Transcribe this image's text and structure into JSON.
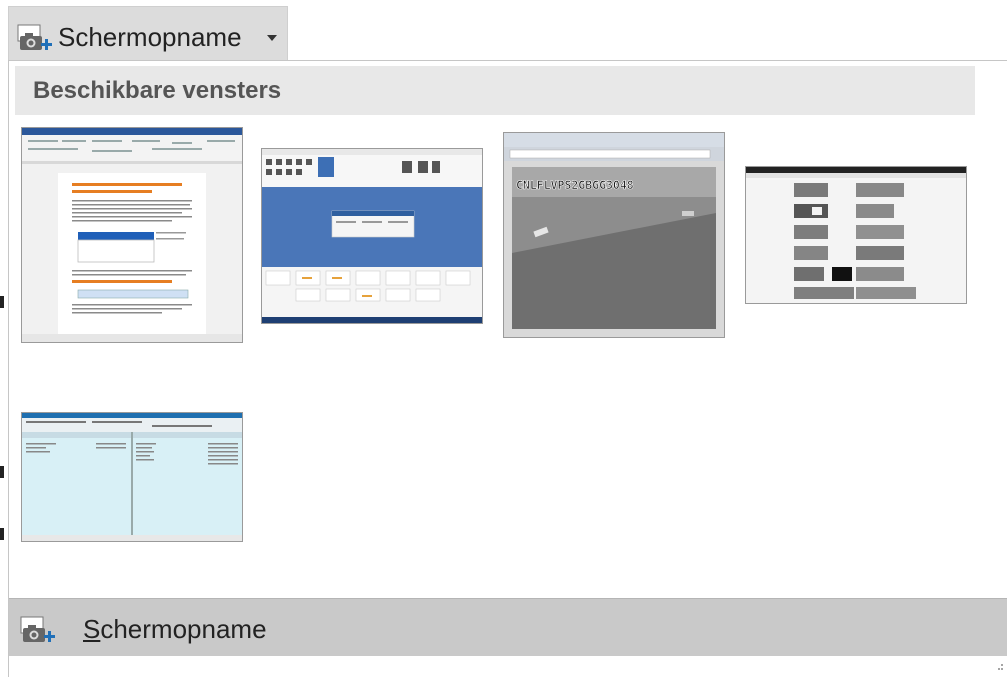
{
  "ribbon": {
    "label": "Schermopname",
    "icon": "camera-plus-icon"
  },
  "section": {
    "title": "Beschikbare vensters"
  },
  "windows": [
    {
      "name": "window-thumbnail-word-document"
    },
    {
      "name": "window-thumbnail-dialog-app"
    },
    {
      "name": "window-thumbnail-camera-viewer",
      "overlay_text": "CNLFLVPS2GBGG3048"
    },
    {
      "name": "window-thumbnail-photo-gallery"
    },
    {
      "name": "window-thumbnail-file-manager"
    }
  ],
  "footer": {
    "label": "Schermopname",
    "icon": "camera-plus-icon"
  },
  "colors": {
    "ribbon_bg": "#dcdcdc",
    "header_bg": "#e8e8e8",
    "footer_bg": "#c9c9c9",
    "accent_blue": "#2b579a"
  }
}
